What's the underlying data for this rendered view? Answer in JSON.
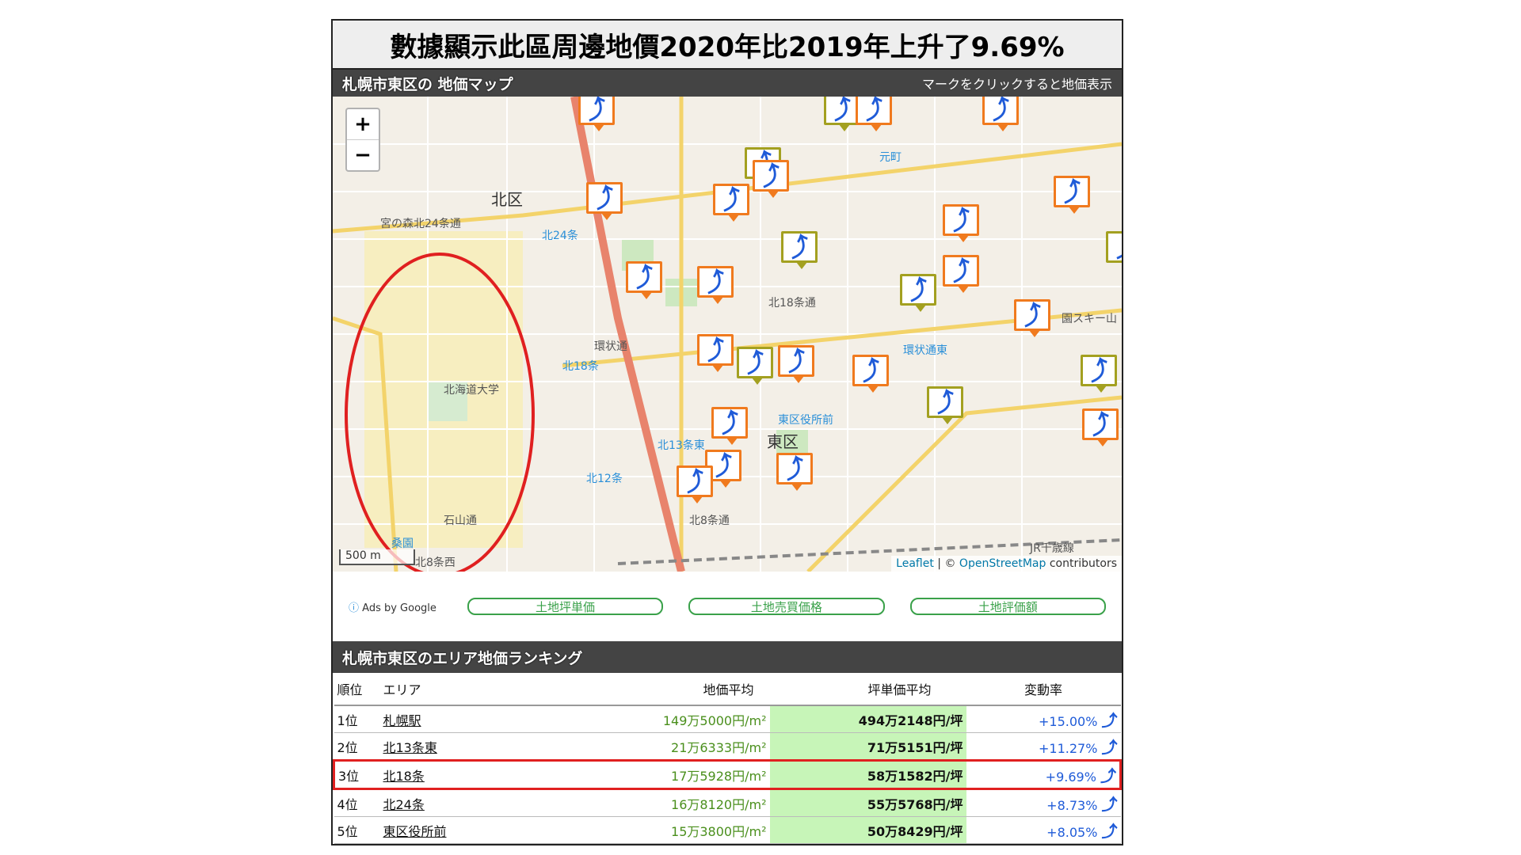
{
  "headline": "數據顯示此區周邊地價2020年比2019年上升了9.69%",
  "map_section": {
    "title": "札幌市東区の 地価マップ",
    "hint": "マークをクリックすると地価表示",
    "zoom_in": "+",
    "zoom_out": "−",
    "scale": "500 m",
    "attribution": {
      "leaflet": "Leaflet",
      "sep": " | © ",
      "osm": "OpenStreetMap",
      "contrib": " contributors"
    },
    "labels": {
      "kita_ku": "北区",
      "higashi_ku": "東区",
      "kita24": "北24条",
      "kita18": "北18条",
      "kita13higashi": "北13条東",
      "kita12": "北12条",
      "motomachi": "元町",
      "kanjo_dori_higashi": "環状通東",
      "higashi_kuyakusho": "東区役所前",
      "hokudai": "北海道大学",
      "kuwazono": "桑園",
      "ishiyama": "石山通",
      "kanjo": "環状通",
      "kita18jo": "北18条通",
      "kita8jo": "北8条通",
      "shinodo": "宮の森北24条通",
      "jr": "JR千歳線",
      "kita8nishi": "北8条西",
      "ski": "園スキー山"
    }
  },
  "ads": {
    "label": "Ads by Google",
    "buttons": [
      "土地坪単価",
      "土地売買価格",
      "土地評価額"
    ]
  },
  "ranking": {
    "title": "札幌市東区のエリア地価ランキング",
    "headers": {
      "rank": "順位",
      "area": "エリア",
      "price": "地価平均",
      "tsubo": "坪単価平均",
      "rate": "変動率"
    },
    "rows": [
      {
        "rank": "1位",
        "area": "札幌駅",
        "price": "149万5000円/m²",
        "tsubo": "494万2148円/坪",
        "rate": "+15.00%"
      },
      {
        "rank": "2位",
        "area": "北13条東",
        "price": "21万6333円/m²",
        "tsubo": "71万5151円/坪",
        "rate": "+11.27%"
      },
      {
        "rank": "3位",
        "area": "北18条",
        "price": "17万5928円/m²",
        "tsubo": "58万1582円/坪",
        "rate": "+9.69%"
      },
      {
        "rank": "4位",
        "area": "北24条",
        "price": "16万8120円/m²",
        "tsubo": "55万5768円/坪",
        "rate": "+8.73%"
      },
      {
        "rank": "5位",
        "area": "東区役所前",
        "price": "15万3800円/m²",
        "tsubo": "50万8429円/坪",
        "rate": "+8.05%"
      }
    ],
    "highlight_row": 3
  },
  "colors": {
    "pin_orange": "#f07a1e",
    "pin_green": "#a3a020",
    "arrow_blue": "#1f5bd8",
    "highlight_red": "#e02020",
    "tsubo_bg": "#c7f5b8"
  }
}
